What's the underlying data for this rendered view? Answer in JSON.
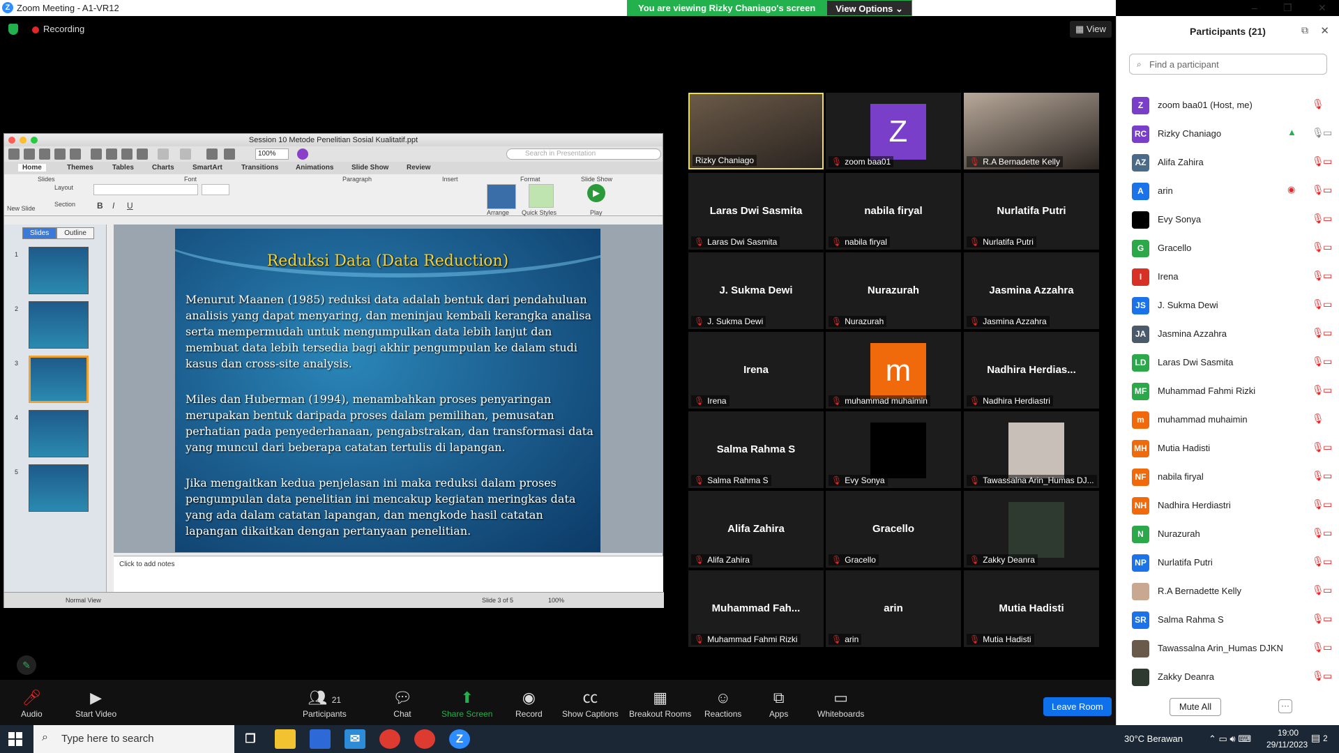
{
  "window": {
    "title": "Zoom Meeting - A1-VR12",
    "minimize": "–",
    "maximize": "❐",
    "close": "✕"
  },
  "banner": {
    "viewing": "You are viewing Rizky Chaniago's screen",
    "view_options": "View Options"
  },
  "top": {
    "recording": "Recording",
    "view": "View"
  },
  "ppt": {
    "filename": "Session 10 Metode Penelitian Sosial Kualitatif.ppt",
    "zoom": "100%",
    "search_placeholder": "Search in Presentation",
    "tabs": [
      "Home",
      "Themes",
      "Tables",
      "Charts",
      "SmartArt",
      "Transitions",
      "Animations",
      "Slide Show",
      "Review"
    ],
    "ribbon_groups": [
      "Slides",
      "Font",
      "Paragraph",
      "Insert",
      "Format",
      "Slide Show"
    ],
    "ribbon_items": {
      "new_slide": "New Slide",
      "layout": "Layout",
      "section": "Section",
      "arrange": "Arrange",
      "quick_styles": "Quick Styles",
      "play": "Play"
    },
    "panel_tabs": [
      "Slides",
      "Outline"
    ],
    "thumb_numbers": [
      "1",
      "2",
      "3",
      "4",
      "5"
    ],
    "slide": {
      "title": "Reduksi Data (Data Reduction)",
      "p1": "Menurut Maanen (1985) reduksi data adalah bentuk dari pendahuluan analisis yang dapat menyaring, dan meninjau kembali kerangka analisa serta mempermudah untuk mengumpulkan data lebih lanjut dan membuat data lebih tersedia bagi akhir pengumpulan ke dalam studi kasus dan cross-site analysis.",
      "p2": "Miles dan Huberman (1994), menambahkan proses penyaringan merupakan bentuk daripada proses dalam pemilihan, pemusatan perhatian pada penyederhanaan, pengabstrakan, dan transformasi data yang muncul dari beberapa catatan tertulis di lapangan.",
      "p3": "Jika mengaitkan kedua penjelasan ini maka reduksi dalam proses pengumpulan data penelitian ini mencakup kegiatan meringkas data yang ada dalam catatan lapangan, dan mengkode hasil catatan lapangan dikaitkan dengan pertanyaan penelitian."
    },
    "notes": "Click to add notes",
    "status": {
      "view": "Normal View",
      "slide": "Slide 3 of 5",
      "zoom": "100%"
    }
  },
  "tiles": [
    {
      "label": "Rizky Chaniago",
      "type": "video",
      "muted": false,
      "bg": "#6b5a48"
    },
    {
      "label": "zoom baa01",
      "type": "avatar",
      "letter": "Z",
      "color": "#7a3fc9",
      "muted": true
    },
    {
      "label": "R.A Bernadette Kelly",
      "type": "video",
      "muted": true,
      "bg": "#b8a99a"
    },
    {
      "label": "Laras Dwi Sasmita",
      "name": "Laras Dwi Sasmita",
      "type": "name",
      "muted": true
    },
    {
      "label": "nabila firyal",
      "name": "nabila firyal",
      "type": "name",
      "muted": true
    },
    {
      "label": "Nurlatifa Putri",
      "name": "Nurlatifa Putri",
      "type": "name",
      "muted": true
    },
    {
      "label": "J. Sukma Dewi",
      "name": "J. Sukma Dewi",
      "type": "name",
      "muted": true
    },
    {
      "label": "Nurazurah",
      "name": "Nurazurah",
      "type": "name",
      "muted": true
    },
    {
      "label": "Jasmina Azzahra",
      "name": "Jasmina Azzahra",
      "type": "name",
      "muted": true
    },
    {
      "label": "Irena",
      "name": "Irena",
      "type": "name",
      "muted": true
    },
    {
      "label": "muhammad muhaimin",
      "type": "avatar",
      "letter": "m",
      "color": "#f06a0c",
      "muted": true
    },
    {
      "label": "Nadhira Herdiastri",
      "name": "Nadhira  Herdias...",
      "type": "name",
      "muted": true
    },
    {
      "label": "Salma Rahma S",
      "name": "Salma Rahma S",
      "type": "name",
      "muted": true
    },
    {
      "label": "Evy Sonya",
      "type": "avatar",
      "letter": "",
      "color": "#000000",
      "muted": true
    },
    {
      "label": "Tawassalna Arin_Humas DJ...",
      "type": "avatar",
      "letter": "",
      "color": "#c8c0b8",
      "muted": true
    },
    {
      "label": "Alifa Zahira",
      "name": "Alifa Zahira",
      "type": "name",
      "muted": true
    },
    {
      "label": "Gracello",
      "name": "Gracello",
      "type": "name",
      "muted": true
    },
    {
      "label": "Zakky Deanra",
      "type": "avatar",
      "letter": "",
      "color": "#2e3a30",
      "muted": true
    },
    {
      "label": "Muhammad Fahmi Rizki",
      "name": "Muhammad  Fah...",
      "type": "name",
      "muted": true
    },
    {
      "label": "arin",
      "name": "arin",
      "type": "name",
      "muted": true
    },
    {
      "label": "Mutia Hadisti",
      "name": "Mutia Hadisti",
      "type": "name",
      "muted": true
    }
  ],
  "toolbar": {
    "audio": "Audio",
    "start_video": "Start Video",
    "participants": "Participants",
    "participants_count": "21",
    "chat": "Chat",
    "share_screen": "Share Screen",
    "record": "Record",
    "show_captions": "Show Captions",
    "breakout_rooms": "Breakout Rooms",
    "reactions": "Reactions",
    "apps": "Apps",
    "whiteboards": "Whiteboards",
    "leave": "Leave Room"
  },
  "participants_panel": {
    "title": "Participants (21)",
    "search_placeholder": "Find a participant",
    "mute_all": "Mute All",
    "more": "···",
    "list": [
      {
        "initials": "Z",
        "name": "zoom baa01 (Host, me)",
        "color": "#7a3fc9",
        "cam": false
      },
      {
        "initials": "RC",
        "name": "Rizky Chaniago",
        "color": "#7a3fc9",
        "cam": true
      },
      {
        "initials": "AZ",
        "name": "Alifa Zahira",
        "color": "#4a6a8a",
        "cam": true
      },
      {
        "initials": "A",
        "name": "arin",
        "color": "#1a73e8",
        "cam": true
      },
      {
        "initials": "",
        "name": "Evy Sonya",
        "color": "#000000",
        "cam": true
      },
      {
        "initials": "G",
        "name": "Gracello",
        "color": "#2ba84a",
        "cam": true
      },
      {
        "initials": "I",
        "name": "Irena",
        "color": "#d93025",
        "cam": true
      },
      {
        "initials": "JS",
        "name": "J. Sukma Dewi",
        "color": "#1a73e8",
        "cam": true
      },
      {
        "initials": "JA",
        "name": "Jasmina Azzahra",
        "color": "#4a5a6a",
        "cam": true
      },
      {
        "initials": "LD",
        "name": "Laras Dwi Sasmita",
        "color": "#2ba84a",
        "cam": true
      },
      {
        "initials": "MF",
        "name": "Muhammad Fahmi Rizki",
        "color": "#2ba84a",
        "cam": true
      },
      {
        "initials": "m",
        "name": "muhammad muhaimin",
        "color": "#f06a0c",
        "cam": false
      },
      {
        "initials": "MH",
        "name": "Mutia Hadisti",
        "color": "#f06a0c",
        "cam": true
      },
      {
        "initials": "NF",
        "name": "nabila firyal",
        "color": "#f06a0c",
        "cam": true
      },
      {
        "initials": "NH",
        "name": "Nadhira Herdiastri",
        "color": "#f06a0c",
        "cam": true
      },
      {
        "initials": "N",
        "name": "Nurazurah",
        "color": "#2ba84a",
        "cam": true
      },
      {
        "initials": "NP",
        "name": "Nurlatifa Putri",
        "color": "#1a73e8",
        "cam": true
      },
      {
        "initials": "",
        "name": "R.A Bernadette Kelly",
        "color": "#c8a890",
        "cam": true
      },
      {
        "initials": "SR",
        "name": "Salma Rahma S",
        "color": "#1a73e8",
        "cam": true
      },
      {
        "initials": "",
        "name": "Tawassalna Arin_Humas DJKN",
        "color": "#6a5a4a",
        "cam": true
      },
      {
        "initials": "",
        "name": "Zakky Deanra",
        "color": "#2e3a30",
        "cam": true
      }
    ]
  },
  "taskbar": {
    "search": "Type here to search",
    "weather": "30°C  Berawan",
    "time": "19:00",
    "date": "29/11/2023",
    "notif": "2"
  }
}
